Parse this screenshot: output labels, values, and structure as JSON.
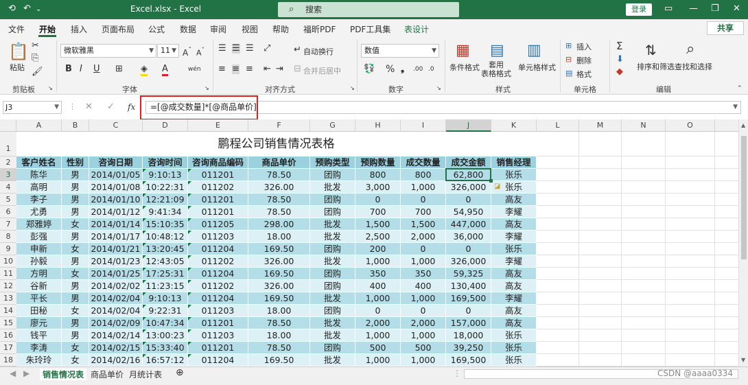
{
  "window": {
    "title": "Excel.xlsx  -  Excel",
    "search_placeholder": "搜索",
    "login_label": "登录"
  },
  "menu": {
    "tabs": [
      "文件",
      "开始",
      "插入",
      "页面布局",
      "公式",
      "数据",
      "审阅",
      "视图",
      "帮助",
      "福昕PDF",
      "PDF工具集",
      "表设计"
    ],
    "active_tab": "开始",
    "share_label": "共享"
  },
  "ribbon": {
    "clipboard": {
      "paste": "粘贴",
      "group": "剪贴板"
    },
    "font": {
      "name": "微软雅黑",
      "size": "11",
      "group": "字体",
      "bold": "B",
      "italic": "I",
      "underline": "U"
    },
    "alignment": {
      "wrap": "自动换行",
      "merge": "合并后居中",
      "group": "对齐方式"
    },
    "number": {
      "format": "数值",
      "group": "数字"
    },
    "styles": {
      "conditional": "条件格式",
      "table_format": "套用\n表格格式",
      "cell_styles": "单元格样式",
      "group": "样式"
    },
    "cells": {
      "insert": "插入",
      "delete": "删除",
      "format": "格式",
      "group": "单元格"
    },
    "editing": {
      "sort": "排序和筛选",
      "find": "查找和选择",
      "group": "编辑"
    }
  },
  "formula_bar": {
    "name_box": "J3",
    "fx": "fx",
    "formula": "=[@成交数量]*[@商品单价]"
  },
  "sheet": {
    "columns": [
      "A",
      "B",
      "C",
      "D",
      "E",
      "F",
      "G",
      "H",
      "I",
      "J",
      "K",
      "L",
      "M",
      "N",
      "O"
    ],
    "selected_column": "J",
    "selected_row": "3",
    "title": "鹏程公司销售情况表格",
    "headers": [
      "客户姓名",
      "性别",
      "咨询日期",
      "咨询时间",
      "咨询商品编码",
      "商品单价",
      "预购类型",
      "预购数量",
      "成交数量",
      "成交金额",
      "销售经理"
    ],
    "rows": [
      [
        "陈华",
        "男",
        "2014/01/05",
        "9:10:13",
        "011201",
        "78.50",
        "团购",
        "800",
        "800",
        "62,800",
        "张乐"
      ],
      [
        "高明",
        "男",
        "2014/01/08",
        "10:22:31",
        "011202",
        "326.00",
        "批发",
        "3,000",
        "1,000",
        "326,000",
        "张乐"
      ],
      [
        "李子",
        "男",
        "2014/01/10",
        "12:21:09",
        "011201",
        "78.50",
        "团购",
        "0",
        "0",
        "0",
        "高友"
      ],
      [
        "尤勇",
        "男",
        "2014/01/12",
        "9:41:34",
        "011201",
        "78.50",
        "团购",
        "700",
        "700",
        "54,950",
        "李耀"
      ],
      [
        "郑雅婷",
        "女",
        "2014/01/14",
        "15:10:35",
        "011205",
        "298.00",
        "批发",
        "1,500",
        "1,500",
        "447,000",
        "高友"
      ],
      [
        "彭强",
        "男",
        "2014/01/17",
        "10:48:12",
        "011203",
        "18.00",
        "批发",
        "2,500",
        "2,000",
        "36,000",
        "李耀"
      ],
      [
        "申新",
        "女",
        "2014/01/21",
        "13:20:45",
        "011204",
        "169.50",
        "团购",
        "200",
        "0",
        "0",
        "张乐"
      ],
      [
        "孙毅",
        "男",
        "2014/01/23",
        "12:43:05",
        "011202",
        "326.00",
        "批发",
        "1,000",
        "1,000",
        "326,000",
        "李耀"
      ],
      [
        "方明",
        "女",
        "2014/01/25",
        "17:25:31",
        "011204",
        "169.50",
        "团购",
        "350",
        "350",
        "59,325",
        "高友"
      ],
      [
        "谷新",
        "男",
        "2014/02/02",
        "11:23:15",
        "011202",
        "326.00",
        "团购",
        "400",
        "400",
        "130,400",
        "高友"
      ],
      [
        "平长",
        "男",
        "2014/02/04",
        "9:10:13",
        "011204",
        "169.50",
        "批发",
        "1,000",
        "1,000",
        "169,500",
        "李耀"
      ],
      [
        "田秘",
        "女",
        "2014/02/04",
        "9:22:31",
        "011203",
        "18.00",
        "团购",
        "0",
        "0",
        "0",
        "高友"
      ],
      [
        "廖元",
        "男",
        "2014/02/09",
        "10:47:34",
        "011201",
        "78.50",
        "批发",
        "2,000",
        "2,000",
        "157,000",
        "高友"
      ],
      [
        "钱平",
        "男",
        "2014/02/14",
        "13:00:23",
        "011203",
        "18.00",
        "批发",
        "1,000",
        "1,000",
        "18,000",
        "张乐"
      ],
      [
        "李涛",
        "女",
        "2014/02/15",
        "15:33:40",
        "011201",
        "78.50",
        "团购",
        "500",
        "500",
        "39,250",
        "张乐"
      ],
      [
        "朱玲玲",
        "女",
        "2014/02/16",
        "16:57:12",
        "011204",
        "169.50",
        "批发",
        "1,000",
        "1,000",
        "169,500",
        "张乐"
      ]
    ]
  },
  "sheet_tabs": [
    "销售情况表",
    "商品单价",
    "月统计表"
  ],
  "active_sheet": "销售情况表",
  "watermark": "CSDN @aaaa0334",
  "colors": {
    "brand": "#217346",
    "header_fill": "#9bd1de",
    "band_dark": "#b3dde7",
    "band_light": "#dcf0f5",
    "highlight": "#e02020"
  }
}
